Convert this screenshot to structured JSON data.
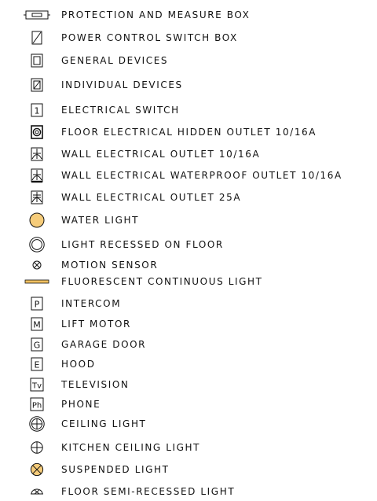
{
  "legend": {
    "items": [
      {
        "symbol": "protection-box-icon",
        "label": "PROTECTION AND MEASURE BOX"
      },
      {
        "symbol": "switch-box-icon",
        "label": "POWER CONTROL SWITCH BOX"
      },
      {
        "symbol": "general-devices-icon",
        "label": "GENERAL DEVICES"
      },
      {
        "symbol": "individual-devices-icon",
        "label": "INDIVIDUAL DEVICES"
      },
      {
        "symbol": "electrical-switch-icon",
        "label": "ELECTRICAL SWITCH",
        "glyph": "1"
      },
      {
        "symbol": "floor-outlet-icon",
        "label": "FLOOR ELECTRICAL HIDDEN OUTLET 10/16A"
      },
      {
        "symbol": "wall-outlet-icon",
        "label": "WALL ELECTRICAL OUTLET 10/16A"
      },
      {
        "symbol": "waterproof-outlet-icon",
        "label": "WALL ELECTRICAL WATERPROOF OUTLET 10/16A"
      },
      {
        "symbol": "wall-outlet-25a-icon",
        "label": "WALL ELECTRICAL OUTLET 25A"
      },
      {
        "symbol": "water-light-icon",
        "label": "WATER LIGHT"
      },
      {
        "symbol": "recessed-floor-light-icon",
        "label": "LIGHT RECESSED ON FLOOR"
      },
      {
        "symbol": "motion-sensor-icon",
        "label": "MOTION SENSOR"
      },
      {
        "symbol": "fluorescent-light-icon",
        "label": "FLUORESCENT CONTINUOUS LIGHT"
      },
      {
        "symbol": "intercom-icon",
        "label": "INTERCOM",
        "glyph": "P"
      },
      {
        "symbol": "lift-motor-icon",
        "label": "LIFT MOTOR",
        "glyph": "M"
      },
      {
        "symbol": "garage-door-icon",
        "label": "GARAGE DOOR",
        "glyph": "G"
      },
      {
        "symbol": "hood-icon",
        "label": "HOOD",
        "glyph": "E"
      },
      {
        "symbol": "television-icon",
        "label": "TELEVISION",
        "glyph": "Tv"
      },
      {
        "symbol": "phone-icon",
        "label": "PHONE",
        "glyph": "Ph"
      },
      {
        "symbol": "ceiling-light-icon",
        "label": "CEILING LIGHT"
      },
      {
        "symbol": "kitchen-ceiling-light-icon",
        "label": "KITCHEN CEILING LIGHT"
      },
      {
        "symbol": "suspended-light-icon",
        "label": "SUSPENDED LIGHT"
      },
      {
        "symbol": "floor-semi-recessed-light-icon",
        "label": "FLOOR SEMI-RECESSED LIGHT"
      }
    ]
  },
  "colors": {
    "line": "#111111",
    "light_fill": "#f6cc7a",
    "fluorescent_fill": "#f0c060"
  }
}
